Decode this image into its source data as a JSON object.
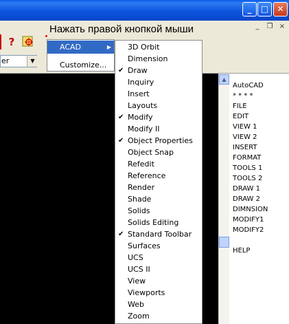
{
  "window": {
    "minimize": "_",
    "maximize": "□",
    "close": "✕"
  },
  "mdi_controls": {
    "minimize": "_",
    "restore": "❐",
    "close": "×"
  },
  "instruction": "Нажать правой кнопкой мыши",
  "toolbar": {
    "help": "?",
    "combo_value": "er",
    "combo_arrow": "▼"
  },
  "context_menu": {
    "items": [
      {
        "label": "ACAD",
        "arrow": "▶"
      },
      {
        "label": "Customize..."
      }
    ]
  },
  "submenu": {
    "items": [
      {
        "label": "3D Orbit",
        "checked": false
      },
      {
        "label": "Dimension",
        "checked": false
      },
      {
        "label": "Draw",
        "checked": true
      },
      {
        "label": "Inquiry",
        "checked": false
      },
      {
        "label": "Insert",
        "checked": false
      },
      {
        "label": "Layouts",
        "checked": false
      },
      {
        "label": "Modify",
        "checked": true
      },
      {
        "label": "Modify II",
        "checked": false
      },
      {
        "label": "Object Properties",
        "checked": true
      },
      {
        "label": "Object Snap",
        "checked": false
      },
      {
        "label": "Refedit",
        "checked": false
      },
      {
        "label": "Reference",
        "checked": false
      },
      {
        "label": "Render",
        "checked": false
      },
      {
        "label": "Shade",
        "checked": false
      },
      {
        "label": "Solids",
        "checked": false
      },
      {
        "label": "Solids Editing",
        "checked": false
      },
      {
        "label": "Standard Toolbar",
        "checked": true
      },
      {
        "label": "Surfaces",
        "checked": false
      },
      {
        "label": "UCS",
        "checked": false
      },
      {
        "label": "UCS II",
        "checked": false
      },
      {
        "label": "View",
        "checked": false
      },
      {
        "label": "Viewports",
        "checked": false
      },
      {
        "label": "Web",
        "checked": false
      },
      {
        "label": "Zoom",
        "checked": false
      }
    ],
    "check_glyph": "✔"
  },
  "scrollbar": {
    "up": "▲",
    "down": "▼"
  },
  "screen_menu": {
    "items": [
      "AutoCAD",
      "* * * *",
      "FILE",
      "EDIT",
      "VIEW 1",
      "VIEW 2",
      "INSERT",
      "FORMAT",
      "TOOLS 1",
      "TOOLS 2",
      "DRAW 1",
      "DRAW 2",
      "DIMNSION",
      "MODIFY1",
      "MODIFY2",
      "",
      "HELP"
    ]
  },
  "colors": {
    "titlebar": "#0b54dd",
    "menu_highlight": "#316ac5",
    "canvas": "#000000"
  }
}
